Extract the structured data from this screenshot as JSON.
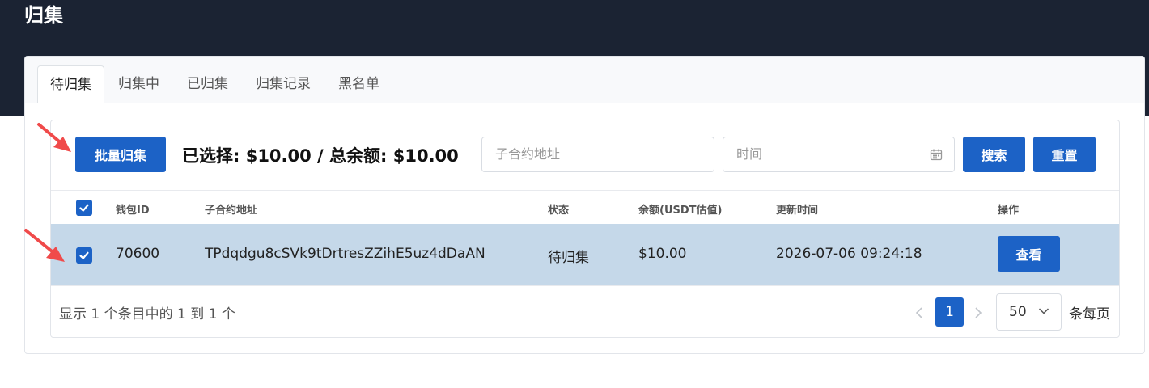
{
  "page": {
    "title": "归集"
  },
  "tabs": [
    {
      "label": "待归集"
    },
    {
      "label": "归集中"
    },
    {
      "label": "已归集"
    },
    {
      "label": "归集记录"
    },
    {
      "label": "黑名单"
    }
  ],
  "toolbar": {
    "batch_button": "批量归集",
    "summary": "已选择: $10.00 / 总余额: $10.00",
    "address_placeholder": "子合约地址",
    "time_placeholder": "时间",
    "search_button": "搜索",
    "reset_button": "重置"
  },
  "table": {
    "headers": [
      "钱包ID",
      "子合约地址",
      "状态",
      "余额(USDT估值)",
      "更新时间",
      "操作"
    ],
    "rows": [
      {
        "checked": true,
        "wallet_id": "70600",
        "address": "TPdqdgu8cSVk9tDrtresZZihE5uz4dDaAN",
        "status": "待归集",
        "balance": "$10.00",
        "updated": "2026-07-06 09:24:18",
        "action": "查看"
      }
    ]
  },
  "pagination": {
    "info": "显示 1 个条目中的 1 到 1 个",
    "current_page": "1",
    "page_size": "50",
    "per_page_label": "条每页"
  },
  "colors": {
    "header_bg": "#1b2333",
    "primary": "#1c62c6",
    "selected_row": "#c5d8e9",
    "annotation_arrow": "#f04a4a"
  }
}
